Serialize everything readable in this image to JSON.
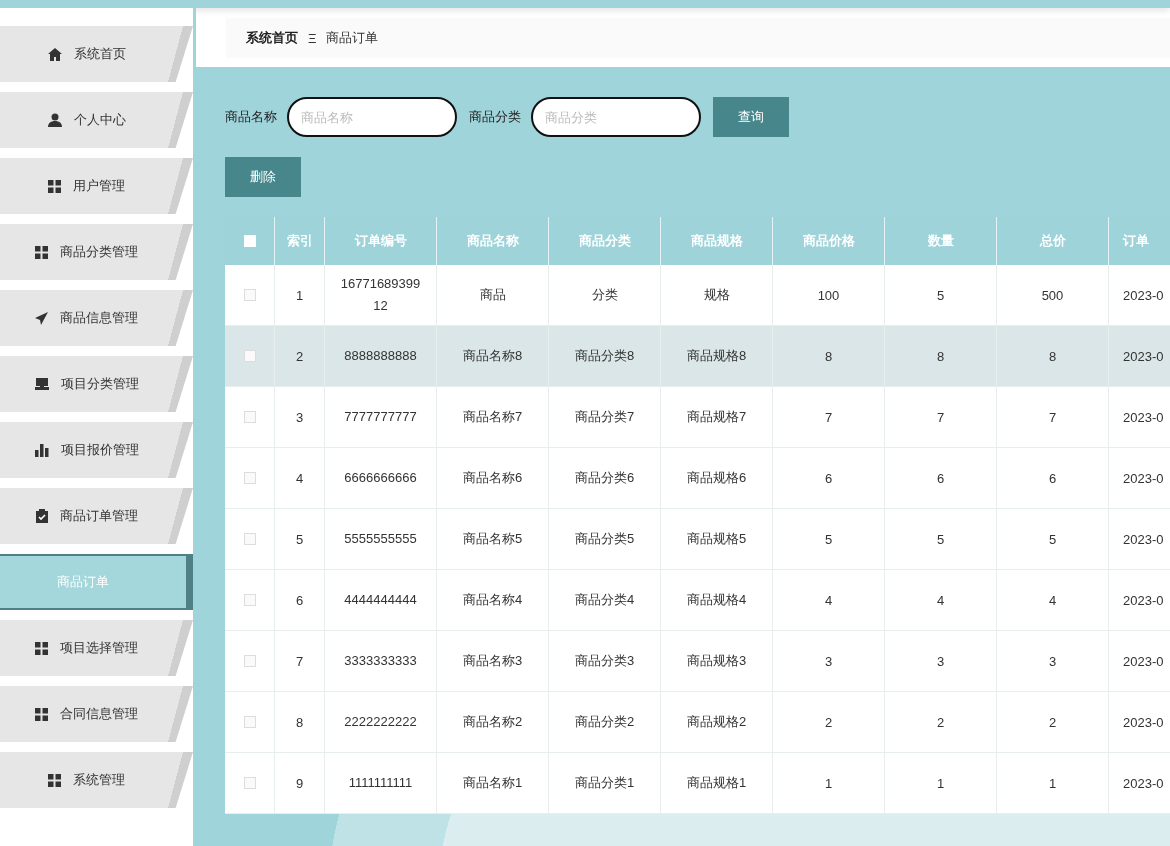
{
  "sidebar": {
    "items": [
      {
        "label": "系统首页",
        "selected": false
      },
      {
        "label": "个人中心",
        "selected": false
      },
      {
        "label": "用户管理",
        "selected": false
      },
      {
        "label": "商品分类管理",
        "selected": false
      },
      {
        "label": "商品信息管理",
        "selected": false
      },
      {
        "label": "项目分类管理",
        "selected": false
      },
      {
        "label": "项目报价管理",
        "selected": false
      },
      {
        "label": "商品订单管理",
        "selected": false
      },
      {
        "label": "商品订单",
        "selected": true
      },
      {
        "label": "项目选择管理",
        "selected": false
      },
      {
        "label": "合同信息管理",
        "selected": false
      },
      {
        "label": "系统管理",
        "selected": false
      }
    ]
  },
  "breadcrumb": {
    "home": "系统首页",
    "separator": "Ξ",
    "current": "商品订单"
  },
  "search": {
    "fields": [
      {
        "label": "商品名称",
        "placeholder": "商品名称"
      },
      {
        "label": "商品分类",
        "placeholder": "商品分类"
      }
    ],
    "button": "查询"
  },
  "delete_button": "删除",
  "table": {
    "header_checked": false,
    "columns": [
      "索引",
      "订单编号",
      "商品名称",
      "商品分类",
      "商品规格",
      "商品价格",
      "数量",
      "总价",
      "订单"
    ],
    "rows": [
      {
        "checked": false,
        "hovered": false,
        "cells": [
          "1",
          "1677168939912",
          "商品",
          "分类",
          "规格",
          "100",
          "5",
          "500",
          "2023-0"
        ]
      },
      {
        "checked": false,
        "hovered": true,
        "cells": [
          "2",
          "8888888888",
          "商品名称8",
          "商品分类8",
          "商品规格8",
          "8",
          "8",
          "8",
          "2023-0"
        ]
      },
      {
        "checked": false,
        "hovered": false,
        "cells": [
          "3",
          "7777777777",
          "商品名称7",
          "商品分类7",
          "商品规格7",
          "7",
          "7",
          "7",
          "2023-0"
        ]
      },
      {
        "checked": false,
        "hovered": false,
        "cells": [
          "4",
          "6666666666",
          "商品名称6",
          "商品分类6",
          "商品规格6",
          "6",
          "6",
          "6",
          "2023-0"
        ]
      },
      {
        "checked": false,
        "hovered": false,
        "cells": [
          "5",
          "5555555555",
          "商品名称5",
          "商品分类5",
          "商品规格5",
          "5",
          "5",
          "5",
          "2023-0"
        ]
      },
      {
        "checked": false,
        "hovered": false,
        "cells": [
          "6",
          "4444444444",
          "商品名称4",
          "商品分类4",
          "商品规格4",
          "4",
          "4",
          "4",
          "2023-0"
        ]
      },
      {
        "checked": false,
        "hovered": false,
        "cells": [
          "7",
          "3333333333",
          "商品名称3",
          "商品分类3",
          "商品规格3",
          "3",
          "3",
          "3",
          "2023-0"
        ]
      },
      {
        "checked": false,
        "hovered": false,
        "cells": [
          "8",
          "2222222222",
          "商品名称2",
          "商品分类2",
          "商品规格2",
          "2",
          "2",
          "2",
          "2023-0"
        ]
      },
      {
        "checked": false,
        "hovered": false,
        "cells": [
          "9",
          "1111111111",
          "商品名称1",
          "商品分类1",
          "商品规格1",
          "1",
          "1",
          "1",
          "2023-0"
        ]
      }
    ]
  }
}
